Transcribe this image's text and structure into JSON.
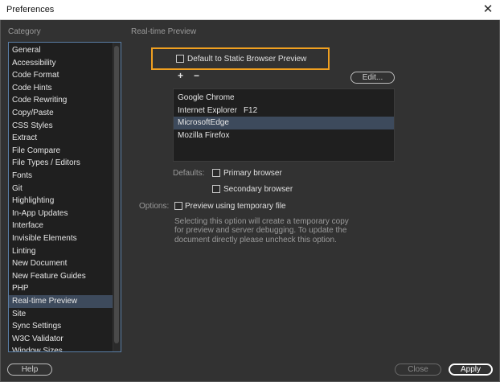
{
  "window": {
    "title": "Preferences",
    "close_glyph": "✕"
  },
  "category": {
    "header": "Category",
    "items": [
      "General",
      "Accessibility",
      "Code Format",
      "Code Hints",
      "Code Rewriting",
      "Copy/Paste",
      "CSS Styles",
      "Extract",
      "File Compare",
      "File Types / Editors",
      "Fonts",
      "Git",
      "Highlighting",
      "In-App Updates",
      "Interface",
      "Invisible Elements",
      "Linting",
      "New Document",
      "New Feature Guides",
      "PHP",
      "Real-time Preview",
      "Site",
      "Sync Settings",
      "W3C Validator",
      "Window Sizes"
    ],
    "selected_index": 20
  },
  "panel": {
    "header": "Real-time Preview",
    "default_static_label": "Default to Static Browser Preview",
    "plus": "+",
    "minus": "−",
    "edit_label": "Edit...",
    "browsers": [
      {
        "name": "Google Chrome",
        "shortcut": ""
      },
      {
        "name": "Internet Explorer",
        "shortcut": "F12"
      },
      {
        "name": "MicrosoftEdge",
        "shortcut": ""
      },
      {
        "name": "Mozilla Firefox",
        "shortcut": ""
      }
    ],
    "selected_browser_index": 2,
    "defaults_label": "Defaults:",
    "primary_label": "Primary browser",
    "secondary_label": "Secondary browser",
    "options_label": "Options:",
    "temp_label": "Preview using temporary file",
    "description": [
      "Selecting this option will create a temporary copy",
      "for preview and server debugging. To update the",
      "document directly please uncheck this option."
    ]
  },
  "footer": {
    "help": "Help",
    "close": "Close",
    "apply": "Apply"
  }
}
